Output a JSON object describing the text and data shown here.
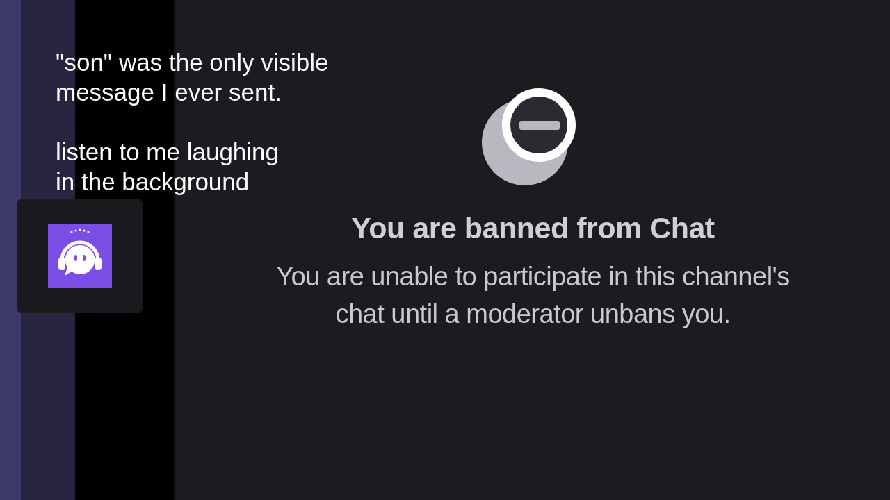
{
  "caption": {
    "paragraphs": [
      {
        "lines": [
          "\"son\" was the only visible",
          "message I ever sent."
        ]
      },
      {
        "lines": [
          "listen to me laughing",
          "in the background"
        ]
      }
    ]
  },
  "banned_notice": {
    "title": "You are banned from Chat",
    "message": "You are unable to participate in this channel's chat until a moderator unbans you."
  }
}
